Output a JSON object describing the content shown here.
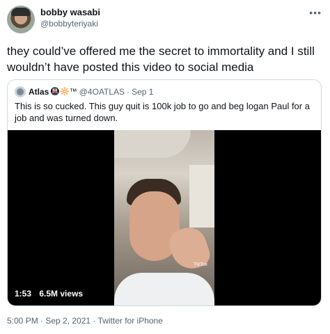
{
  "author": {
    "name": "bobby wasabi",
    "handle": "@bobbyteriyaki"
  },
  "more_icon": "ellipsis-icon",
  "tweet_text": "they could’ve offered me the secret to immortality and I still wouldn’t have posted this video to social media",
  "quoted": {
    "name": "Atlas",
    "emoji": "🚇🔆™",
    "handle": "@4OATLAS",
    "separator": "·",
    "date": "Sep 1",
    "text": "This is so cucked. This guy quit is 100k job to go and beg logan Paul for a job and was turned down.",
    "video": {
      "duration": "1:53",
      "views": "6.5M views",
      "watermark": "TikTok"
    }
  },
  "meta": "5:00 PM · Sep 2, 2021 · Twitter for iPhone"
}
